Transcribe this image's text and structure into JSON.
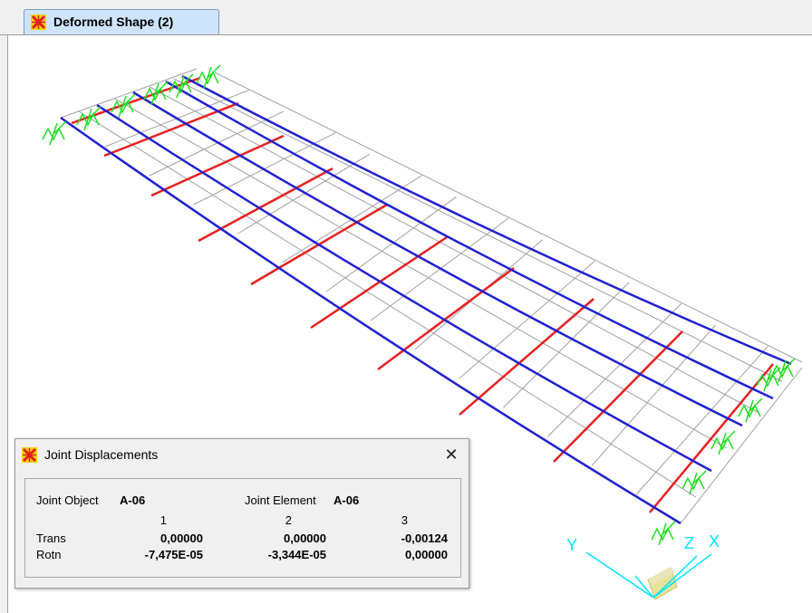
{
  "tab": {
    "label": "Deformed Shape (2)",
    "icon": "sap2000-logo-icon"
  },
  "dialog": {
    "title": "Joint Displacements",
    "close_label": "✕",
    "joint_object_label": "Joint Object",
    "joint_object_value": "A-06",
    "joint_element_label": "Joint Element",
    "joint_element_value": "A-06",
    "columns": [
      "1",
      "2",
      "3"
    ],
    "rows": [
      {
        "label": "Trans",
        "values": [
          "0,00000",
          "0,00000",
          "-0,00124"
        ]
      },
      {
        "label": "Rotn",
        "values": [
          "-7,475E-05",
          "-3,344E-05",
          "0,00000"
        ]
      }
    ]
  },
  "axes": {
    "x_label": "X",
    "y_label": "Y",
    "z_label": "Z",
    "color": "#00e5ff"
  },
  "colors": {
    "beam": "#2020d0",
    "crossbeam": "#e82020",
    "mesh": "#a0a0a0",
    "support": "#22dd22"
  }
}
